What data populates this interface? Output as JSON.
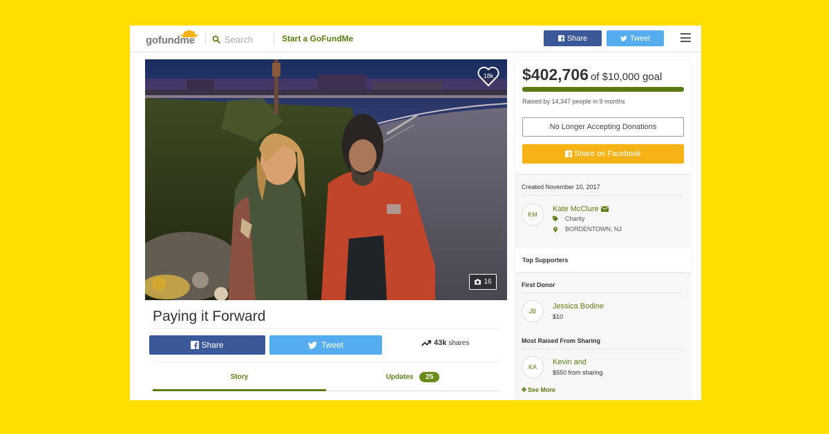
{
  "header": {
    "logo": "gofundme",
    "search_placeholder": "Search",
    "start_link": "Start a GoFundMe",
    "share_label": "Share",
    "tweet_label": "Tweet"
  },
  "campaign": {
    "heart_count": "18k",
    "photo_count": "16",
    "title": "Paying it Forward",
    "share_label": "Share",
    "tweet_label": "Tweet",
    "shares_count": "43k",
    "shares_label": "shares",
    "tabs": {
      "story": "Story",
      "updates": "Updates",
      "updates_count": "25"
    }
  },
  "donation": {
    "raised_amount": "$402,706",
    "goal_text": "of $10,000 goal",
    "progress_percent": 100,
    "raised_by": "Raised by 14,347 people in 9 months",
    "no_longer_label": "No Longer Accepting Donations",
    "share_fb_label": "Share on Facebook"
  },
  "organizer": {
    "created": "Created November 10, 2017",
    "initials": "KM",
    "name": "Kate McClure",
    "category": "Charity",
    "location": "BORDENTOWN, NJ"
  },
  "supporters": {
    "top_title": "Top Supporters",
    "first_donor_title": "First Donor",
    "first_donor": {
      "initials": "JB",
      "name": "Jessica Bodine",
      "amount": "$10"
    },
    "sharing_title": "Most Raised From Sharing",
    "sharer": {
      "initials": "KA",
      "name": "Kevin and",
      "amount": "$550 from sharing"
    },
    "see_more": "See More"
  },
  "colors": {
    "background": "#FFDE00",
    "brand_green": "#5a7b14",
    "facebook": "#3b5998",
    "twitter": "#55acee",
    "share_orange": "#f7b316"
  },
  "icons": [
    "search-icon",
    "facebook-icon",
    "twitter-icon",
    "heart-icon",
    "camera-icon",
    "trend-up-icon",
    "envelope-icon",
    "tag-icon",
    "map-pin-icon",
    "plus-icon",
    "menu-icon"
  ]
}
